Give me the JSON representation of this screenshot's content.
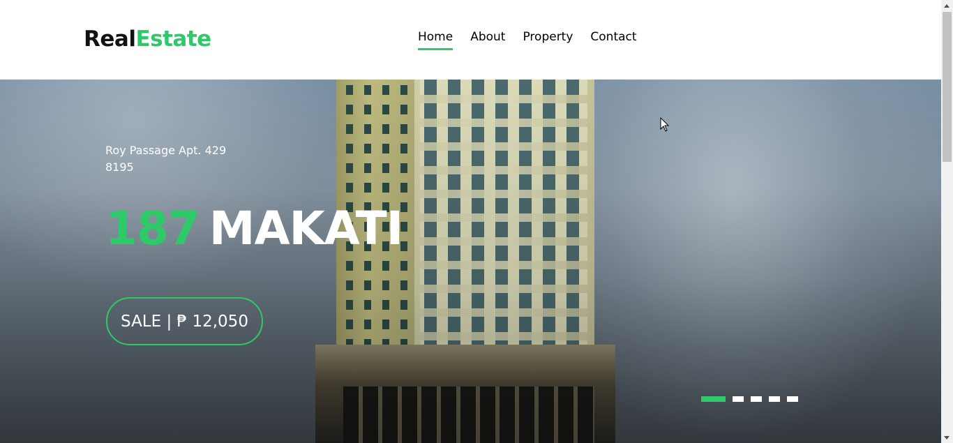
{
  "header": {
    "logo_part1": "Real",
    "logo_part2": "Estate",
    "nav": [
      {
        "label": "Home",
        "active": true
      },
      {
        "label": "About",
        "active": false
      },
      {
        "label": "Property",
        "active": false
      },
      {
        "label": "Contact",
        "active": false
      }
    ]
  },
  "hero": {
    "address_line1": "Roy Passage Apt. 429",
    "address_line2": "8195",
    "title_number": "187",
    "title_text": "MAKATI",
    "price_label": "SALE | ₱ 12,050",
    "slides_total": 5,
    "active_slide": 1
  },
  "colors": {
    "accent": "#2eca6a",
    "text_dark": "#000000",
    "text_light": "#ffffff"
  }
}
